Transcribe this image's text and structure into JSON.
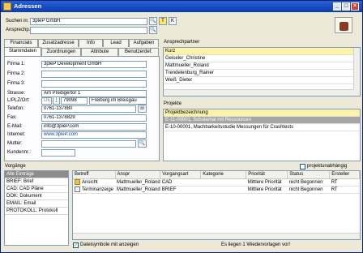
{
  "window": {
    "title": "Adressen",
    "min": "_",
    "max": "□",
    "close": "×"
  },
  "search": {
    "suchen_label": "Suchen in:",
    "suchen_value": "3pleP GmbH",
    "ansprech_label": "Ansprechp.",
    "ansprech_value": "",
    "t_btn": "T",
    "k_btn": "K"
  },
  "tabs_top": [
    "Financials",
    "Zusatzadresse",
    "Info",
    "Lead",
    "Aufgaben"
  ],
  "tabs_bottom": [
    "Stammdaten",
    "Zuordnungen",
    "Attribute",
    "Benutzerdef."
  ],
  "form": {
    "firma1_label": "Firma 1:",
    "firma1": "3pleP Development GmbH",
    "firma2_label": "Firma 2:",
    "firma2": "",
    "firma3_label": "Firma 3:",
    "firma3": "",
    "strasse_label": "Strasse:",
    "strasse": "Am Predigertor 1",
    "lplz_label": "L/PLZ/Ort:",
    "land": "DE",
    "plz": "79098",
    "ort": "Freiburg im Breisgau",
    "telefon_label": "Telefon:",
    "telefon": "0761-137880",
    "fax_label": "Fax:",
    "fax": "0761-1378829",
    "email_label": "E-Mail:",
    "email": "info@3pleP.com",
    "internet_label": "Internet:",
    "internet": "www.3pleP.com",
    "mutter_label": "Mutter:",
    "mutter": "",
    "kundennr_label": "Kundennr.:",
    "kundennr": ""
  },
  "ansprechpartner": {
    "title": "Ansprechpartner",
    "header": "Kurz",
    "items": [
      "Geiseler_Christine",
      "Mattmueller_Roland",
      "Trendelenburg_Rainer",
      "Weiß_Dieter"
    ]
  },
  "projekte": {
    "title": "Projekte",
    "header": "Projektbezeichnung",
    "items": [
      "E-11-00001, Schulamat mit Ressourcen",
      "E-10-00001, Machbarkeitsstudie Messungen für Crashtests"
    ]
  },
  "vorgaenge": {
    "title": "Vorgänge",
    "projektunabhaengig": "projektunabhängig",
    "filters": [
      "Alle Einträge",
      "BRIEF: Brief",
      "CAD: CAD Pläne",
      "DOK: Dokument",
      "EMAIL: Email",
      "PROTOKOLL: Protokoll"
    ],
    "columns": [
      "Betreff",
      "Anspr",
      "Vorgangsart",
      "Kategorie",
      "Priorität",
      "Status",
      "Ersteller"
    ],
    "rows": [
      [
        "Ansicht",
        "Mattmueller_Roland",
        "CAD",
        "",
        "Mittlere Priorität",
        "nicht Begonnen",
        "RT"
      ],
      [
        "Terminanzeige",
        "Mattmueller_Roland",
        "BRIEF",
        "",
        "Mittlere Priorität",
        "nicht Begonnen",
        "RT"
      ]
    ],
    "dateisymbole": "Dateisymbole mit anzeigen",
    "status_text": "Es liegen 1 Wiedervorlagen vor!"
  }
}
